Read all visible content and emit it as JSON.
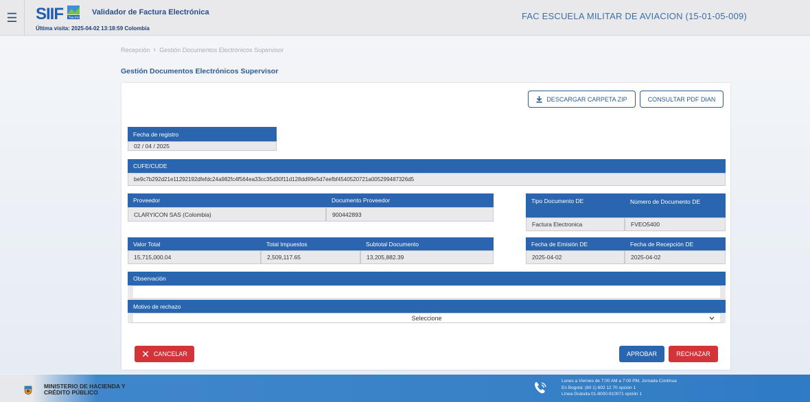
{
  "header": {
    "app_title": "Validador de Factura Electrónica",
    "last_visit": "Última visita: 2025-04-02 13:18:59 Colombia",
    "entity": "FAC ESCUELA MILITAR DE AVIACION (15-01-05-009)",
    "logo_text": "SIIF Nación"
  },
  "breadcrumb": {
    "items": [
      "Recepción",
      "Gestión Documentos Electrónicos Supervisor"
    ]
  },
  "page_title": "Gestión Documentos Electrónicos Supervisor",
  "actions": {
    "download_zip": "DESCARGAR CARPETA ZIP",
    "consult_pdf": "CONSULTAR PDF DIAN"
  },
  "form": {
    "fecha_registro": {
      "label": "Fecha de registro",
      "value": "02 / 04 / 2025"
    },
    "cufe": {
      "label": "CUFE/CUDE",
      "value": "be9c7b292d21e11292192dfefdc24a982fc4f564ea33cc35d30f11d128dd99e5d7eefbf4540520721a005299487326d5"
    },
    "proveedor": {
      "label": "Proveedor",
      "value": "CLARYICON SAS (Colombia)"
    },
    "documento_proveedor": {
      "label": "Documento Proveedor",
      "value": "900442893"
    },
    "tipo_documento": {
      "label": "Tipo Documento DE",
      "value": "Factura Electronica"
    },
    "numero_documento": {
      "label": "Número de Documento DE",
      "value": "FVEO5400"
    },
    "valor_total": {
      "label": "Valor Total",
      "value": "15,715,000.04"
    },
    "total_impuestos": {
      "label": "Total Impuestos",
      "value": "2,509,117.65"
    },
    "subtotal": {
      "label": "Subtotal Documento",
      "value": "13,205,882.39"
    },
    "fecha_emision": {
      "label": "Fecha de Emisión DE",
      "value": "2025-04-02"
    },
    "fecha_recepcion": {
      "label": "Fecha de Recepción DE",
      "value": "2025-04-02"
    },
    "observacion": {
      "label": "Observación",
      "value": ""
    },
    "motivo_rechazo": {
      "label": "Motivo de rechazo",
      "selected": "Seleccione"
    }
  },
  "buttons": {
    "cancel": "CANCELAR",
    "approve": "APROBAR",
    "reject": "RECHAZAR"
  },
  "colors": {
    "primary": "#2a66b0",
    "danger": "#d3343a",
    "approve": "#2a66b0"
  },
  "footer": {
    "ministry_line1": "MINISTERIO DE HACIENDA Y",
    "ministry_line2": "CRÉDITO PÚBLICO",
    "contact_line1": "Lunes a Viernes de 7:00 AM a 7:00 PM, Jornada Continua",
    "contact_line2": "En Bogotá: (60 1) 602 12 70 opción 1",
    "contact_line3": "Línea Gratuita 01-8000-910071 opción 1"
  }
}
